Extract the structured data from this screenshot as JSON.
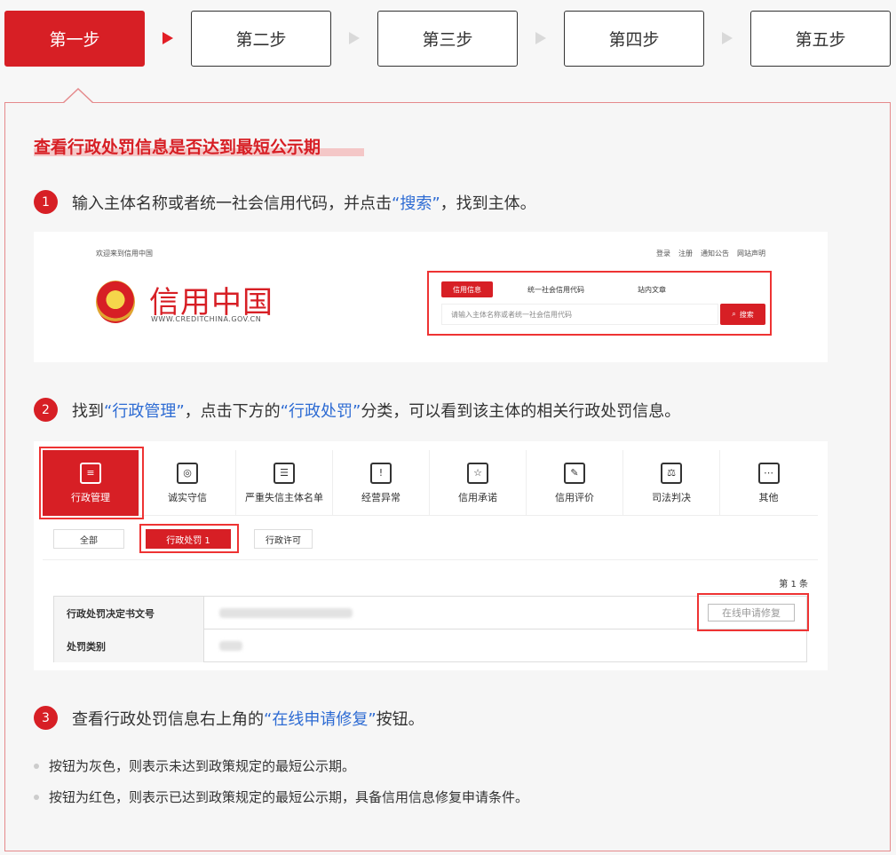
{
  "steps": [
    {
      "label": "第一步",
      "active": true
    },
    {
      "label": "第二步",
      "active": false
    },
    {
      "label": "第三步",
      "active": false
    },
    {
      "label": "第四步",
      "active": false
    },
    {
      "label": "第五步",
      "active": false
    }
  ],
  "panel": {
    "title": "查看行政处罚信息是否达到最短公示期",
    "step1": {
      "num": "1",
      "pre": "输入主体名称或者统一社会信用代码，并点击",
      "link": "“搜索”",
      "post": "，找到主体。"
    },
    "step2": {
      "num": "2",
      "pre": "找到",
      "link1": "“行政管理”",
      "mid": "，点击下方的",
      "link2": "“行政处罚”",
      "post": "分类，可以看到该主体的相关行政处罚信息。"
    },
    "step3": {
      "num": "3",
      "pre": "查看行政处罚信息右上角的",
      "link": "“在线申请修复”",
      "post": "按钮。"
    },
    "notes": [
      "按钮为灰色，则表示未达到政策规定的最短公示期。",
      "按钮为红色，则表示已达到政策规定的最短公示期，具备信用信息修复申请条件。"
    ]
  },
  "shot1": {
    "welcome": "欢迎来到信用中国",
    "links": [
      "登录",
      "注册",
      "通知公告",
      "网站声明"
    ],
    "logo": "信用中国",
    "url": "WWW.CREDITCHINA.GOV.CN",
    "tabs": [
      "信用信息",
      "统一社会信用代码",
      "站内文章"
    ],
    "placeholder": "请输入主体名称或者统一社会信用代码",
    "search": "搜索"
  },
  "shot2": {
    "categories": [
      {
        "label": "行政管理",
        "icon": "document-icon"
      },
      {
        "label": "诚实守信",
        "icon": "shield-icon"
      },
      {
        "label": "严重失信主体名单",
        "icon": "list-icon"
      },
      {
        "label": "经营异常",
        "icon": "alarm-icon"
      },
      {
        "label": "信用承诺",
        "icon": "promise-icon"
      },
      {
        "label": "信用评价",
        "icon": "evaluation-icon"
      },
      {
        "label": "司法判决",
        "icon": "judgment-icon"
      },
      {
        "label": "其他",
        "icon": "other-icon"
      }
    ],
    "filters": [
      "全部",
      "行政处罚  1",
      "行政许可"
    ],
    "count": "第 1 条",
    "rows": [
      "行政处罚决定书文号",
      "处罚类别"
    ],
    "repair": "在线申请修复"
  }
}
